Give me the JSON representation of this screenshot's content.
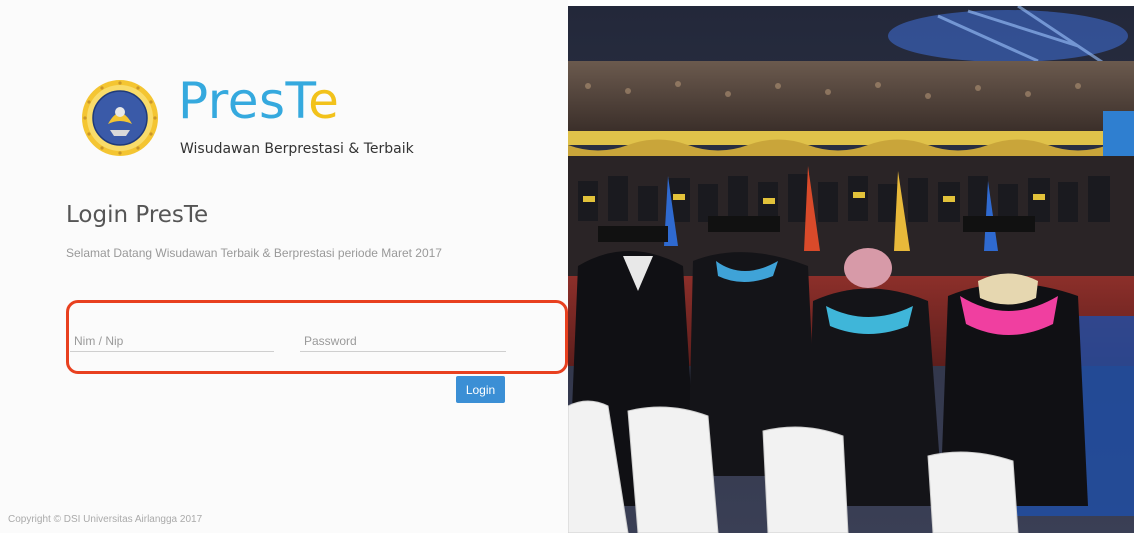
{
  "brand": {
    "name_main": "PresT",
    "name_accent": "e",
    "tagline": "Wisudawan Berprestasi & Terbaik",
    "emblem": "university-seal"
  },
  "login": {
    "title": "Login PresTe",
    "welcome": "Selamat Datang Wisudawan Terbaik & Berprestasi periode Maret 2017",
    "nim_placeholder": "Nim / Nip",
    "password_placeholder": "Password",
    "button": "Login"
  },
  "footer": {
    "copyright": "Copyright © DSI Universitas Airlangga 2017"
  },
  "photo": {
    "subject": "graduation ceremony"
  },
  "colors": {
    "brand_blue": "#35a9de",
    "brand_yellow": "#f2c21b",
    "highlight_red": "#e8401f",
    "button_blue": "#3b8fd5"
  }
}
